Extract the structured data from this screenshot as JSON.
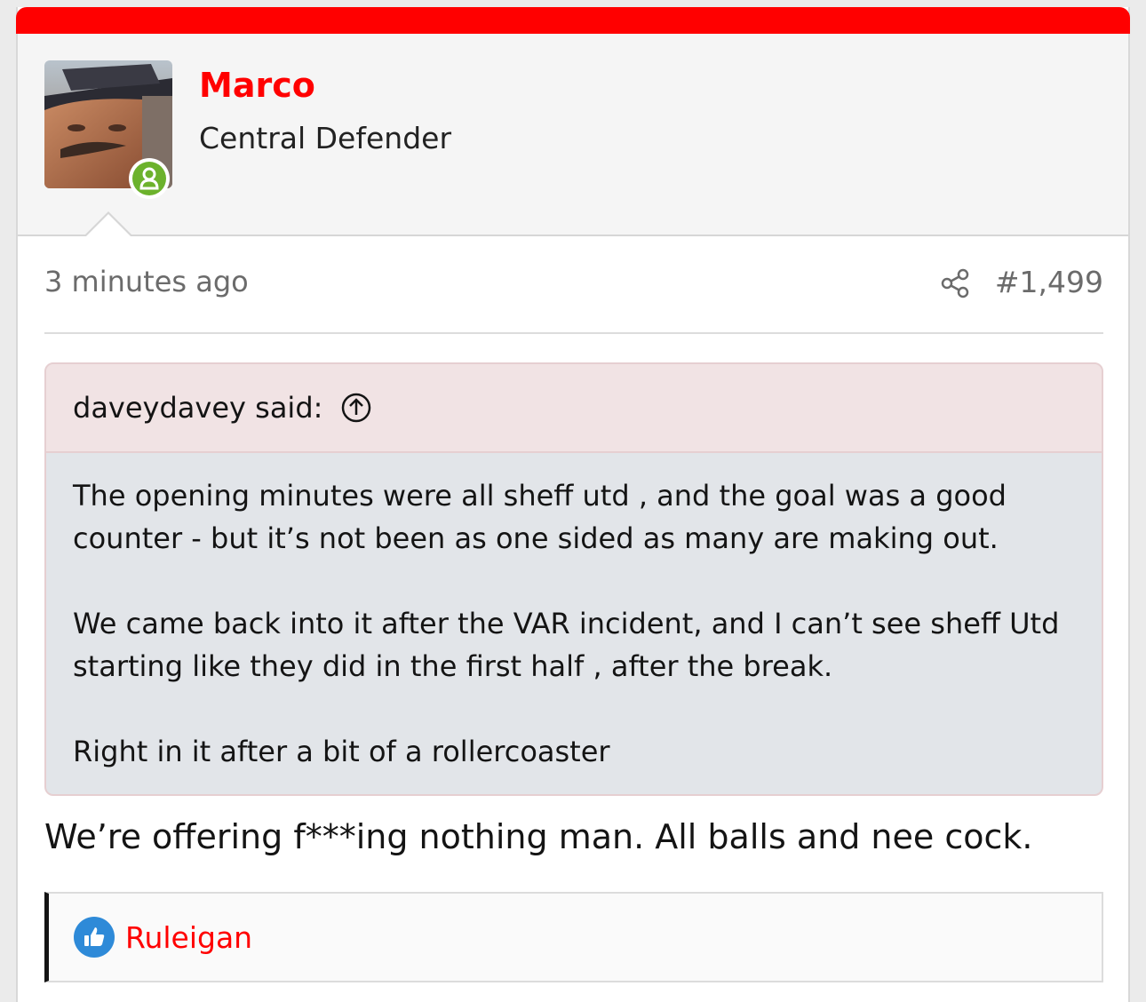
{
  "colors": {
    "accent": "#ff0000",
    "online": "#6cb22c",
    "like": "#2e8ad8"
  },
  "user": {
    "name": "Marco",
    "title": "Central Defender",
    "status_icon": "user-online-icon"
  },
  "meta": {
    "time": "3 minutes ago",
    "post_number": "#1,499",
    "share_icon": "share-icon"
  },
  "quote": {
    "author": "daveydavey said:",
    "jump_icon": "arrow-up-circle-icon",
    "paragraphs": [
      "The opening minutes were all sheff utd , and the goal was a good counter - but it’s not been as one sided as many are making out.",
      "We came back into it after the VAR incident, and I can’t see sheff Utd starting like they did in the first half , after the break.",
      "Right in it after a bit of a rollercoaster"
    ]
  },
  "message": "We’re offering f***ing nothing man. All balls and nee cock.",
  "reactions": {
    "icon": "thumbs-up-icon",
    "user": "Ruleigan"
  }
}
